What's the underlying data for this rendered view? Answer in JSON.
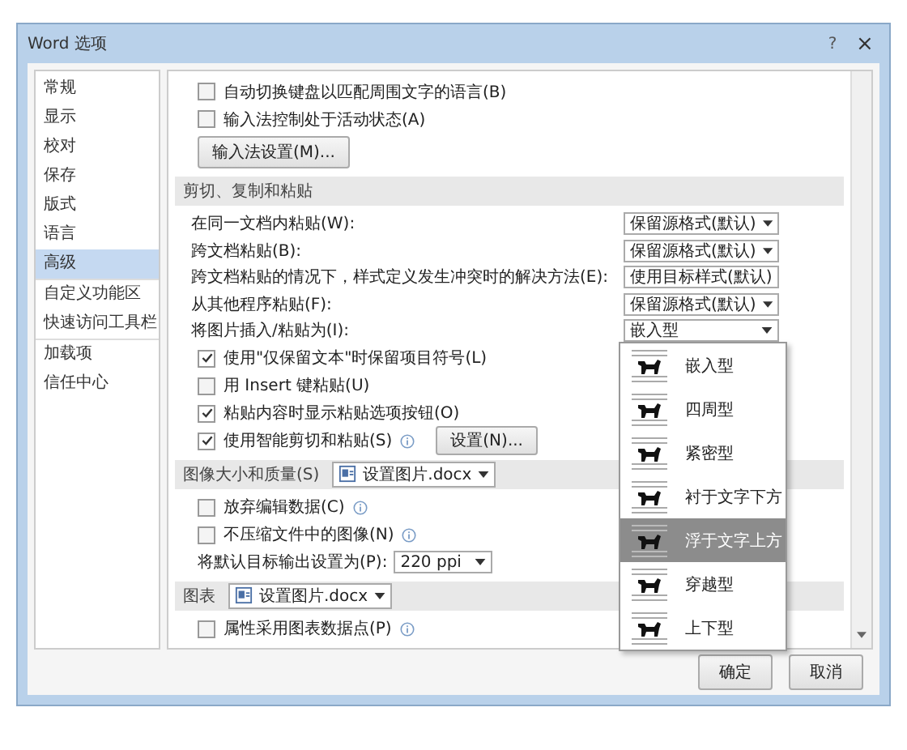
{
  "window": {
    "title": "Word 选项",
    "controls": [
      {
        "kind": "help",
        "label": "?"
      },
      {
        "kind": "close",
        "label": "×"
      }
    ]
  },
  "sidebar": {
    "items": [
      {
        "label": "常规",
        "selected": false
      },
      {
        "label": "显示",
        "selected": false
      },
      {
        "label": "校对",
        "selected": false
      },
      {
        "label": "保存",
        "selected": false
      },
      {
        "label": "版式",
        "selected": false
      },
      {
        "label": "语言",
        "selected": false
      },
      {
        "label": "高级",
        "selected": true
      },
      {
        "label": "自定义功能区",
        "selected": false,
        "group_start": true
      },
      {
        "label": "快速访问工具栏",
        "selected": false
      },
      {
        "label": "加载项",
        "selected": false,
        "group_start": true
      },
      {
        "label": "信任中心",
        "selected": false
      }
    ]
  },
  "content": {
    "rows": [
      {
        "kind": "checkbox",
        "label": "自动切换键盘以匹配周围文字的语言(B)",
        "checked": false
      },
      {
        "kind": "checkbox",
        "label": "输入法控制处于活动状态(A)",
        "checked": false
      },
      {
        "kind": "button",
        "label": "输入法设置(M)..."
      },
      {
        "kind": "heading",
        "label": "剪切、复制和粘贴"
      },
      {
        "kind": "setting",
        "label": "在同一文档内粘贴(W):",
        "value": "保留源格式(默认)"
      },
      {
        "kind": "setting",
        "label": "跨文档粘贴(B):",
        "value": "保留源格式(默认)"
      },
      {
        "kind": "setting",
        "label": "跨文档粘贴的情况下，样式定义发生冲突时的解决方法(E):",
        "value": "使用目标样式(默认)"
      },
      {
        "kind": "setting",
        "label": "从其他程序粘贴(F):",
        "value": "保留源格式(默认)"
      },
      {
        "kind": "setting",
        "label": "将图片插入/粘贴为(I):",
        "value": "嵌入型"
      },
      {
        "kind": "checkbox",
        "label": "使用\"仅保留文本\"时保留项目符号(L)",
        "checked": true
      },
      {
        "kind": "checkbox",
        "label": "用 Insert 键粘贴(U)",
        "checked": false
      },
      {
        "kind": "checkbox",
        "label": "粘贴内容时显示粘贴选项按钮(O)",
        "checked": true
      },
      {
        "kind": "checkbox",
        "label": "使用智能剪切和粘贴(S)",
        "checked": true,
        "info": true,
        "button": "设置(N)..."
      },
      {
        "kind": "heading",
        "label": "图像大小和质量(S)",
        "file": "设置图片.docx"
      },
      {
        "kind": "checkbox",
        "label": "放弃编辑数据(C)",
        "checked": false,
        "info": true
      },
      {
        "kind": "checkbox",
        "label": "不压缩文件中的图像(N)",
        "checked": false,
        "info": true
      },
      {
        "kind": "inline_select",
        "label": "将默认目标输出设置为(P):",
        "value": "220 ppi"
      },
      {
        "kind": "heading",
        "label": "图表",
        "file": "设置图片.docx"
      },
      {
        "kind": "checkbox",
        "label": "属性采用图表数据点(P)",
        "checked": false,
        "info": true
      }
    ]
  },
  "wrap_menu": {
    "items": [
      {
        "label": "嵌入型",
        "selected": false
      },
      {
        "label": "四周型",
        "selected": false
      },
      {
        "label": "紧密型",
        "selected": false
      },
      {
        "label": "衬于文字下方",
        "selected": false
      },
      {
        "label": "浮于文字上方",
        "selected": true
      },
      {
        "label": "穿越型",
        "selected": false
      },
      {
        "label": "上下型",
        "selected": false
      }
    ]
  },
  "buttons": [
    "确定",
    "取消"
  ]
}
